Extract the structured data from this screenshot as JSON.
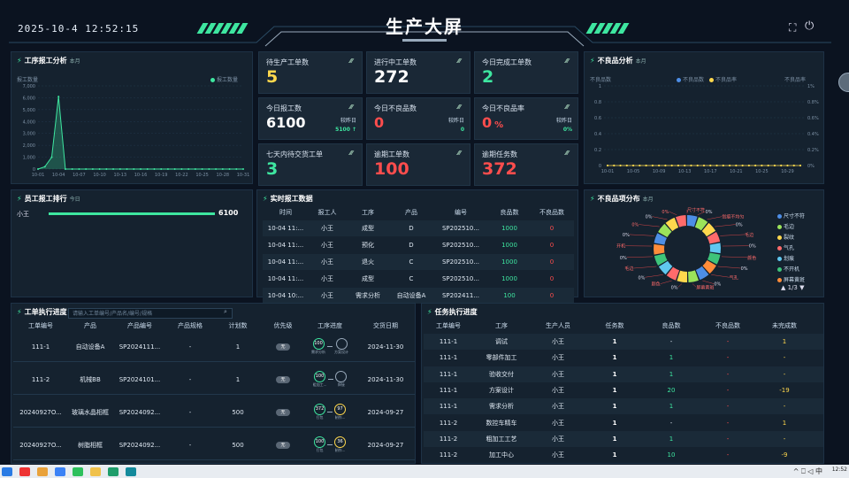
{
  "header": {
    "datetime": "2025-10-4 12:52:15",
    "title": "生产大屏"
  },
  "kpis": [
    {
      "label": "待生产工单数",
      "value": "5",
      "color": "#ffd84d"
    },
    {
      "label": "进行中工单数",
      "value": "272",
      "color": "#ffffff"
    },
    {
      "label": "今日完成工单数",
      "value": "2",
      "color": "#3ee6a0"
    },
    {
      "label": "今日报工数",
      "value": "6100",
      "color": "#ffffff",
      "cmp_label": "较昨日",
      "cmp_value": "5100 ↑"
    },
    {
      "label": "今日不良品数",
      "value": "0",
      "color": "#ff4d4d",
      "cmp_label": "较昨日",
      "cmp_value": "0"
    },
    {
      "label": "今日不良品率",
      "value": "0",
      "unit": "%",
      "color": "#ff4d4d",
      "cmp_label": "较昨日",
      "cmp_value": "0%"
    },
    {
      "label": "七天内待交货工单",
      "value": "3",
      "color": "#3ee6a0"
    },
    {
      "label": "逾期工单数",
      "value": "100",
      "color": "#ff4d4d"
    },
    {
      "label": "逾期任务数",
      "value": "372",
      "color": "#ff4d4d"
    }
  ],
  "report_chart": {
    "title": "工序报工分析",
    "sub": "本月",
    "ylabel": "报工数量",
    "legend": "报工数量",
    "chart_data": {
      "type": "area",
      "ylim": [
        0,
        7000
      ],
      "yticks": [
        "7,000",
        "6,000",
        "5,000",
        "4,000",
        "3,000",
        "2,000",
        "1,000",
        "0"
      ],
      "x": [
        "10-01",
        "10-02",
        "10-03",
        "10-04",
        "10-05",
        "10-06",
        "10-07",
        "10-08",
        "10-09",
        "10-10",
        "10-11",
        "10-12",
        "10-13",
        "10-14",
        "10-15",
        "10-16",
        "10-17",
        "10-18",
        "10-19",
        "10-20",
        "10-21",
        "10-22",
        "10-23",
        "10-24",
        "10-25",
        "10-26",
        "10-27",
        "10-28",
        "10-29",
        "10-30",
        "10-31"
      ],
      "xlabels": [
        "10-01",
        "10-04",
        "10-07",
        "10-10",
        "10-13",
        "10-16",
        "10-19",
        "10-22",
        "10-25",
        "10-28",
        "10-31"
      ],
      "values": [
        0,
        200,
        1000,
        6100,
        0,
        0,
        0,
        0,
        0,
        0,
        0,
        0,
        0,
        0,
        0,
        0,
        0,
        0,
        0,
        0,
        0,
        0,
        0,
        0,
        0,
        0,
        0,
        0,
        0,
        0,
        0
      ]
    }
  },
  "defect_chart": {
    "title": "不良品分析",
    "sub": "本月",
    "ylabel_left": "不良品数",
    "ylabel_right": "不良品率",
    "legend1": "不良品数",
    "legend2": "不良品率",
    "chart_data": {
      "type": "line",
      "ylim": [
        0,
        1
      ],
      "yticks_left": [
        "1",
        "0.8",
        "0.6",
        "0.4",
        "0.2",
        "0"
      ],
      "yticks_right": [
        "1%",
        "0.8%",
        "0.6%",
        "0.4%",
        "0.2%",
        "0%"
      ],
      "xlabels": [
        "10-01",
        "10-05",
        "10-09",
        "10-13",
        "10-17",
        "10-21",
        "10-25",
        "10-29"
      ],
      "values": [
        0,
        0,
        0,
        0,
        0,
        0,
        0,
        0,
        0,
        0,
        0,
        0,
        0,
        0,
        0,
        0,
        0,
        0,
        0,
        0,
        0,
        0,
        0,
        0,
        0,
        0,
        0,
        0,
        0,
        0,
        0
      ]
    }
  },
  "staff_rank": {
    "title": "员工报工排行",
    "sub": "今日",
    "items": [
      {
        "name": "小王",
        "value": "6100"
      }
    ]
  },
  "realtime": {
    "title": "实时报工数据",
    "columns": [
      "时间",
      "报工人",
      "工序",
      "产品",
      "编号",
      "良品数",
      "不良品数"
    ],
    "rows": [
      [
        "10-04 11:...",
        "小王",
        "成型",
        "D",
        "SP202510...",
        "1000",
        "0"
      ],
      [
        "10-04 11:...",
        "小王",
        "预化",
        "D",
        "SP202510...",
        "1000",
        "0"
      ],
      [
        "10-04 11:...",
        "小王",
        "退火",
        "C",
        "SP202510...",
        "1000",
        "0"
      ],
      [
        "10-04 11:...",
        "小王",
        "成型",
        "C",
        "SP202510...",
        "1000",
        "0"
      ],
      [
        "10-04 10:...",
        "小王",
        "需求分析",
        "自动设备A",
        "SP202411...",
        "100",
        "0"
      ]
    ]
  },
  "defect_dist": {
    "title": "不良品项分布",
    "sub": "本月",
    "page": "1/3",
    "legend": [
      {
        "name": "尺寸不符",
        "color": "#4d8ee6"
      },
      {
        "name": "毛边",
        "color": "#9be35a"
      },
      {
        "name": "裂纹",
        "color": "#ffd84d"
      },
      {
        "name": "气孔",
        "color": "#ff6b6b"
      },
      {
        "name": "划痕",
        "color": "#60c8f0"
      },
      {
        "name": "不开机",
        "color": "#3ec47a"
      },
      {
        "name": "屏幕黄斑",
        "color": "#ff8c3a"
      }
    ],
    "labels": [
      "尺寸不符",
      "0%",
      "划痕不均匀",
      "0%",
      "毛边",
      "0%",
      "颜色",
      "0%",
      "气孔",
      "0%",
      "屏幕黄斑",
      "0%",
      "颜色",
      "0%",
      "毛边",
      "0%",
      "开机",
      "0%",
      "0%",
      "0%",
      "0%"
    ]
  },
  "workorder": {
    "title": "工单执行进度",
    "search_placeholder": "请输入工单编号/产品名/编号/规格",
    "columns": [
      "工单编号",
      "产品",
      "产品编号",
      "产品规格",
      "计划数",
      "优先级",
      "工序进度",
      "交货日期"
    ],
    "rows": [
      {
        "no": "111-1",
        "product": "自动设备A",
        "code": "SP2024111...",
        "spec": "-",
        "plan": "1",
        "prio": "无",
        "p1": "100",
        "p1l": "需求分析",
        "p2": "",
        "p2l": "方案设计",
        "date": "2024-11-30"
      },
      {
        "no": "111-2",
        "product": "机械BB",
        "code": "SP2024101...",
        "spec": "-",
        "plan": "1",
        "prio": "无",
        "p1": "100",
        "p1l": "粗加工...",
        "p2": "",
        "p2l": "焊接",
        "date": "2024-11-30"
      },
      {
        "no": "20240927O...",
        "product": "玻璃水晶相框",
        "code": "SP2024092...",
        "spec": "-",
        "plan": "500",
        "prio": "无",
        "p1": "372",
        "p1l": "打包",
        "p2": "97",
        "p2l": "制作...",
        "date": "2024-09-27"
      },
      {
        "no": "20240927O...",
        "product": "树脂相框",
        "code": "SP2024092...",
        "spec": "-",
        "plan": "500",
        "prio": "无",
        "p1": "100",
        "p1l": "打包",
        "p2": "36",
        "p2l": "制作...",
        "date": "2024-09-27"
      }
    ]
  },
  "tasks": {
    "title": "任务执行进度",
    "columns": [
      "工单编号",
      "工序",
      "生产人员",
      "任务数",
      "良品数",
      "不良品数",
      "未完成数"
    ],
    "rows": [
      [
        "111-1",
        "调试",
        "小王",
        "1",
        "-",
        "-",
        "1"
      ],
      [
        "111-1",
        "零部件加工",
        "小王",
        "1",
        "1",
        "-",
        "-"
      ],
      [
        "111-1",
        "验收交付",
        "小王",
        "1",
        "1",
        "-",
        "-"
      ],
      [
        "111-1",
        "方案设计",
        "小王",
        "1",
        "20",
        "-",
        "-19"
      ],
      [
        "111-1",
        "需求分析",
        "小王",
        "1",
        "1",
        "-",
        "-"
      ],
      [
        "111-2",
        "数控车精车",
        "小王",
        "1",
        "-",
        "-",
        "1"
      ],
      [
        "111-2",
        "粗加工工艺",
        "小王",
        "1",
        "1",
        "-",
        "-"
      ],
      [
        "111-2",
        "加工中心",
        "小王",
        "1",
        "10",
        "-",
        "-9"
      ]
    ]
  },
  "taskbar": {
    "ime": "中",
    "clock": "12:52"
  },
  "colors": {
    "accent": "#3ee6a0",
    "bg": "#0b1320",
    "panel": "#15222f"
  }
}
